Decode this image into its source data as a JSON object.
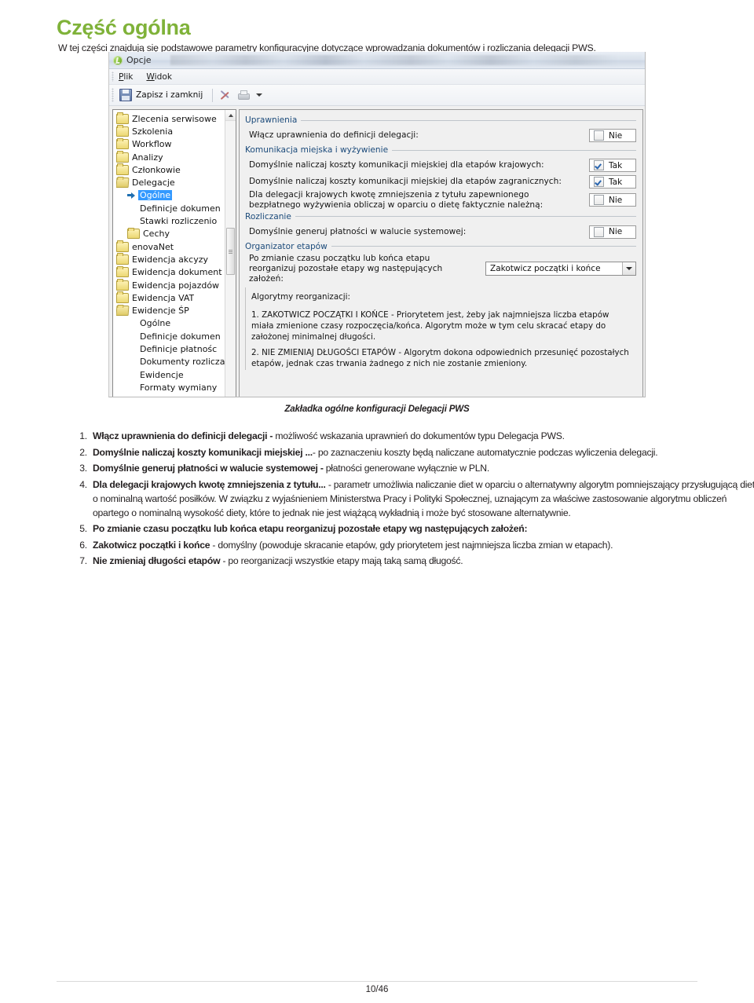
{
  "document": {
    "title": "Część ogólna",
    "intro": "W tej części znajdują się podstawowe parametry konfiguracyjne dotyczące wprowadzania dokumentów i rozliczania delegacji PWS.",
    "caption": "Zakładka ogólne konfiguracji Delegacji PWS",
    "page_number": "10/46",
    "accent_color": "#7fb239"
  },
  "screenshot": {
    "window_title": "Opcje",
    "menus": [
      {
        "label": "Plik",
        "accel": "P",
        "rest": "lik"
      },
      {
        "label": "Widok",
        "accel": "W",
        "rest": "idok"
      }
    ],
    "toolbar": {
      "save_label": "Zapisz i zamknij",
      "icons": [
        "save-icon",
        "tools-icon",
        "print-icon",
        "dropdown-caret-icon"
      ]
    },
    "tree": [
      {
        "label": "Zlecenia serwisowe",
        "level": 1,
        "icon": "folder",
        "selected": false
      },
      {
        "label": "Szkolenia",
        "level": 1,
        "icon": "folder",
        "selected": false
      },
      {
        "label": "Workflow",
        "level": 1,
        "icon": "folder",
        "selected": false
      },
      {
        "label": "Analizy",
        "level": 1,
        "icon": "folder",
        "selected": false
      },
      {
        "label": "Członkowie",
        "level": 1,
        "icon": "folder",
        "selected": false
      },
      {
        "label": "Delegacje",
        "level": 1,
        "icon": "folder-open",
        "selected": false
      },
      {
        "label": "Ogólne",
        "level": 2,
        "icon": "arrow",
        "selected": true
      },
      {
        "label": "Definicje dokumen",
        "level": 3,
        "icon": "none",
        "selected": false
      },
      {
        "label": "Stawki rozliczenio",
        "level": 3,
        "icon": "none",
        "selected": false
      },
      {
        "label": "Cechy",
        "level": 2,
        "icon": "folder",
        "selected": false
      },
      {
        "label": "enovaNet",
        "level": 1,
        "icon": "folder",
        "selected": false
      },
      {
        "label": "Ewidencja akcyzy",
        "level": 1,
        "icon": "folder",
        "selected": false
      },
      {
        "label": "Ewidencja dokument",
        "level": 1,
        "icon": "folder",
        "selected": false
      },
      {
        "label": "Ewidencja pojazdów",
        "level": 1,
        "icon": "folder",
        "selected": false
      },
      {
        "label": "Ewidencja VAT",
        "level": 1,
        "icon": "folder",
        "selected": false
      },
      {
        "label": "Ewidencje ŚP",
        "level": 1,
        "icon": "folder-open",
        "selected": false
      },
      {
        "label": "Ogólne",
        "level": 3,
        "icon": "none",
        "selected": false
      },
      {
        "label": "Definicje dokumen",
        "level": 3,
        "icon": "none",
        "selected": false
      },
      {
        "label": "Definicje płatnośc",
        "level": 3,
        "icon": "none",
        "selected": false
      },
      {
        "label": "Dokumenty rozlicza",
        "level": 3,
        "icon": "none",
        "selected": false
      },
      {
        "label": "Ewidencje",
        "level": 3,
        "icon": "none",
        "selected": false
      },
      {
        "label": "Formaty wymiany",
        "level": 3,
        "icon": "none",
        "selected": false
      }
    ],
    "groups": {
      "uprawnienia": {
        "title": "Uprawnienia",
        "field_label": "Włącz uprawnienia do definicji delegacji:",
        "value": "Nie",
        "checked": false
      },
      "komunikacja": {
        "title": "Komunikacja miejska i wyżywienie",
        "rows": [
          {
            "label": "Domyślnie naliczaj koszty komunikacji miejskiej dla etapów krajowych:",
            "value": "Tak",
            "checked": true
          },
          {
            "label": "Domyślnie naliczaj koszty komunikacji miejskiej dla etapów zagranicznych:",
            "value": "Tak",
            "checked": true
          },
          {
            "label": "Dla delegacji krajowych kwotę zmniejszenia z tytułu zapewnionego bezpłatnego wyżywienia obliczaj w oparciu o dietę faktycznie należną:",
            "value": "Nie",
            "checked": false
          }
        ]
      },
      "rozliczanie": {
        "title": "Rozliczanie",
        "field_label": "Domyślnie generuj płatności w walucie systemowej:",
        "value": "Nie",
        "checked": false
      },
      "organizator": {
        "title": "Organizator etapów",
        "field_label": "Po zmianie czasu początku lub końca etapu reorganizuj pozostałe etapy wg następujących założeń:",
        "selected_option": "Zakotwicz początki i końce",
        "options": [
          "Zakotwicz początki i końce",
          "Nie zmieniaj długości etapów"
        ]
      },
      "algorytmy": {
        "heading": "Algorytmy reorganizacji:",
        "item1": "1. ZAKOTWICZ POCZĄTKI I KOŃCE - Priorytetem jest, żeby jak najmniejsza liczba etapów miała zmienione czasy rozpoczęcia/końca. Algorytm może w tym celu skracać etapy do założonej minimalnej długości.",
        "item2": "2. NIE ZMIENIAJ DŁUGOŚCI ETAPÓW - Algorytm dokona odpowiednich przesunięć pozostałych etapów, jednak czas trwania żadnego z nich nie zostanie zmieniony."
      }
    }
  },
  "notes": [
    {
      "bold": "Włącz uprawnienia do definicji delegacji -",
      "rest": " możliwość wskazania uprawnień do dokumentów typu Delegacja PWS."
    },
    {
      "bold": "Domyślnie naliczaj koszty komunikacji miejskiej ...",
      "rest": "- po zaznaczeniu koszty będą naliczane automatycznie podczas wyliczenia delegacji."
    },
    {
      "bold": "Domyślnie generuj płatności w walucie systemowej -",
      "rest": " płatności generowane wyłącznie w PLN."
    },
    {
      "bold": "Dla delegacji krajowych kwotę zmniejszenia z tytułu...",
      "rest": " - parametr umożliwia naliczanie diet w oparciu o alternatywny algorytm pomniejszający przysługującą dietę o nominalną wartość posiłków. W związku z wyjaśnieniem Ministerstwa Pracy i Polityki Społecznej, uznającym za właściwe zastosowanie algorytmu obliczeń opartego o nominalną wysokość diety, które to jednak nie jest wiążącą wykładnią i może być stosowane alternatywnie."
    },
    {
      "bold": "Po zmianie czasu początku lub końca etapu reorganizuj pozostałe etapy wg następujących założeń:",
      "rest": ""
    },
    {
      "bold": "Zakotwicz początki i końce",
      "rest": " - domyślny (powoduje skracanie etapów, gdy priorytetem jest najmniejsza liczba zmian w etapach)."
    },
    {
      "bold": "Nie zmieniaj długości etapów",
      "rest": " - po reorganizacji wszystkie etapy mają taką samą długość."
    }
  ]
}
